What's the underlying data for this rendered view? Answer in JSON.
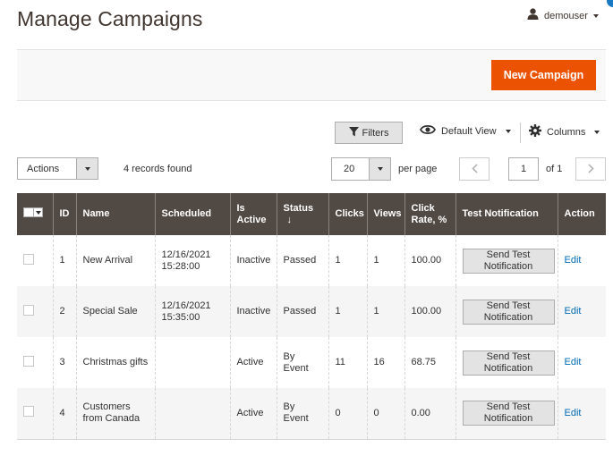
{
  "header": {
    "title": "Manage Campaigns",
    "user_name": "demouser"
  },
  "action_bar": {
    "primary_button": "New Campaign"
  },
  "toolbar": {
    "filters_label": "Filters",
    "view_label": "Default View",
    "columns_label": "Columns",
    "actions_label": "Actions",
    "records_found": "4 records found",
    "per_page_value": "20",
    "per_page_label": "per page",
    "current_page": "1",
    "page_of": "of 1"
  },
  "table": {
    "columns": {
      "id": "ID",
      "name": "Name",
      "scheduled": "Scheduled",
      "is_active": "Is Active",
      "status": "Status",
      "clicks": "Clicks",
      "views": "Views",
      "click_rate": "Click Rate, %",
      "test_notification": "Test Notification",
      "action": "Action"
    },
    "rows": [
      {
        "id": "1",
        "name": "New Arrival",
        "scheduled": "12/16/2021 15:28:00",
        "is_active": "Inactive",
        "status": "Passed",
        "clicks": "1",
        "views": "1",
        "click_rate": "100.00",
        "test_btn": "Send Test Notification",
        "action": "Edit"
      },
      {
        "id": "2",
        "name": "Special Sale",
        "scheduled": "12/16/2021 15:35:00",
        "is_active": "Inactive",
        "status": "Passed",
        "clicks": "1",
        "views": "1",
        "click_rate": "100.00",
        "test_btn": "Send Test Notification",
        "action": "Edit"
      },
      {
        "id": "3",
        "name": "Christmas gifts",
        "scheduled": "",
        "is_active": "Active",
        "status": "By Event",
        "clicks": "11",
        "views": "16",
        "click_rate": "68.75",
        "test_btn": "Send Test Notification",
        "action": "Edit"
      },
      {
        "id": "4",
        "name": "Customers from Canada",
        "scheduled": "",
        "is_active": "Active",
        "status": "By Event",
        "clicks": "0",
        "views": "0",
        "click_rate": "0.00",
        "test_btn": "Send Test Notification",
        "action": "Edit"
      }
    ]
  },
  "icons": {
    "user": "user-icon",
    "filter": "funnel-icon",
    "view": "eye-icon",
    "columns": "gear-icon",
    "prev": "chevron-left-icon",
    "next": "chevron-right-icon"
  },
  "colors": {
    "primary_button": "#eb5202",
    "table_header": "#514943",
    "link": "#006bb4",
    "title": "#41362f"
  }
}
